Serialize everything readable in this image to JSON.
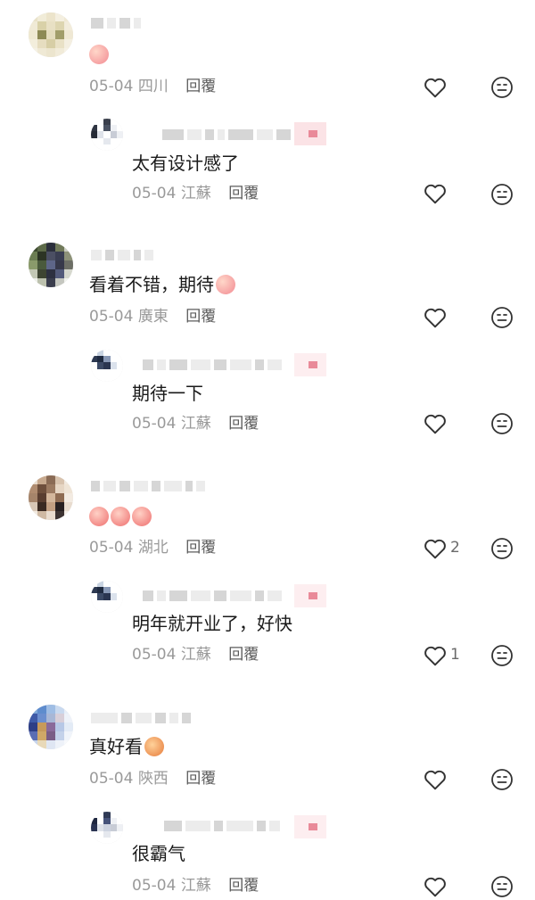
{
  "comments": [
    {
      "text": "",
      "emoji": [
        "peach-emoji"
      ],
      "date": "05-04",
      "location": "四川",
      "reply_label": "回覆",
      "likes": "",
      "reply": {
        "text": "太有设计感了",
        "date": "05-04",
        "location": "江蘇",
        "reply_label": "回覆",
        "likes": ""
      }
    },
    {
      "text": "看着不错，期待",
      "emoji": [
        "peach-emoji"
      ],
      "date": "05-04",
      "location": "廣東",
      "reply_label": "回覆",
      "likes": "",
      "reply": {
        "text": "期待一下",
        "date": "05-04",
        "location": "江蘇",
        "reply_label": "回覆",
        "likes": ""
      }
    },
    {
      "text": "",
      "emoji": [
        "thumbs-up-emoji",
        "thumbs-up-emoji",
        "thumbs-up-emoji"
      ],
      "date": "05-04",
      "location": "湖北",
      "reply_label": "回覆",
      "likes": "2",
      "reply": {
        "text": "明年就开业了，好快",
        "date": "05-04",
        "location": "江蘇",
        "reply_label": "回覆",
        "likes": "1"
      }
    },
    {
      "text": "真好看",
      "emoji": [
        "cat-emoji"
      ],
      "date": "05-04",
      "location": "陝西",
      "reply_label": "回覆",
      "likes": "",
      "reply": {
        "text": "很霸气",
        "date": "05-04",
        "location": "江蘇",
        "reply_label": "回覆",
        "likes": ""
      }
    }
  ],
  "icons": {
    "like": "heart-outline-icon",
    "dislike": "neutral-face-icon"
  },
  "colors": {
    "text": "#1a1a1a",
    "meta": "#9a9a9a",
    "reply_link": "#5c5c5c",
    "icon": "#333333",
    "tag_bg": "#fbe3e6",
    "tag_accent": "#e98a99"
  }
}
